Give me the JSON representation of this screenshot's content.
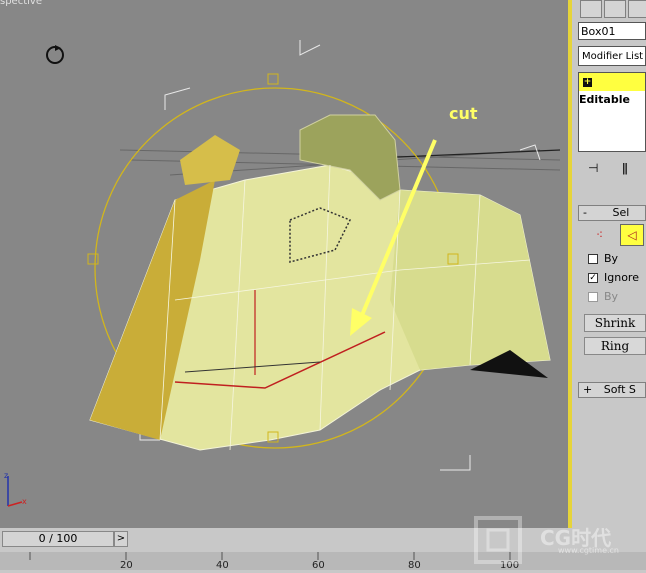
{
  "viewport": {
    "label": "spective",
    "annotation": "cut",
    "accent_color": "#e6d43a"
  },
  "panel": {
    "object_name": "Box01",
    "modifier_list": "Modifier List",
    "stack_item": "Editable",
    "selection_rollout": "Sel",
    "checkbox_by": "By",
    "checkbox_ignore": "Ignore",
    "checkbox_by2": "By",
    "shrink_label": "Shrink",
    "ring_label": "Ring",
    "soft_rollout": "Soft S",
    "icons": [
      "select-icon",
      "curve-icon",
      "pin-icon",
      "fork-icon",
      "vertex-icon",
      "edge-icon"
    ]
  },
  "timeline": {
    "frame_counter": "0 / 100",
    "next_symbol": ">",
    "ticks": [
      "20",
      "40",
      "60",
      "80",
      "100"
    ]
  },
  "watermark": {
    "text": "CG时代",
    "url": "www.cgtime.cn"
  }
}
